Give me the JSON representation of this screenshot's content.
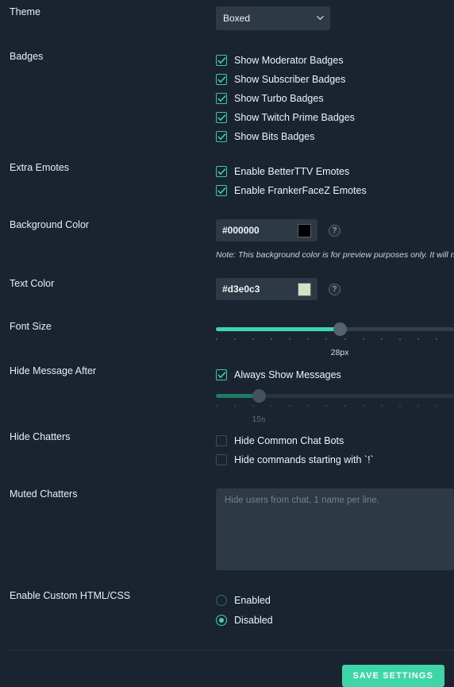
{
  "theme": {
    "label": "Theme",
    "selected": "Boxed",
    "options": [
      "Boxed"
    ],
    "chevron_icon": "chevron-down-icon"
  },
  "badges": {
    "label": "Badges",
    "items": [
      {
        "label": "Show Moderator Badges",
        "checked": true
      },
      {
        "label": "Show Subscriber Badges",
        "checked": true
      },
      {
        "label": "Show Turbo Badges",
        "checked": true
      },
      {
        "label": "Show Twitch Prime Badges",
        "checked": true
      },
      {
        "label": "Show Bits Badges",
        "checked": true
      }
    ]
  },
  "extra_emotes": {
    "label": "Extra Emotes",
    "items": [
      {
        "label": "Enable BetterTTV Emotes",
        "checked": true
      },
      {
        "label": "Enable FrankerFaceZ Emotes",
        "checked": true
      }
    ]
  },
  "background_color": {
    "label": "Background Color",
    "value": "#000000",
    "swatch": "#000000",
    "help_icon": "help-icon",
    "note": "Note: This background color is for preview purposes only. It will not be s"
  },
  "text_color": {
    "label": "Text Color",
    "value": "#d3e0c3",
    "swatch": "#d3e0c3",
    "help_icon": "help-icon"
  },
  "font_size": {
    "label": "Font Size",
    "value": "28px",
    "percent": 52
  },
  "hide_message_after": {
    "label": "Hide Message After",
    "always_show": {
      "label": "Always Show Messages",
      "checked": true
    },
    "value": "15s",
    "percent": 18
  },
  "hide_chatters": {
    "label": "Hide Chatters",
    "items": [
      {
        "label": "Hide Common Chat Bots",
        "checked": false
      },
      {
        "label": "Hide commands starting with `!`",
        "checked": false
      }
    ]
  },
  "muted_chatters": {
    "label": "Muted Chatters",
    "placeholder": "Hide users from chat, 1 name per line.",
    "value": ""
  },
  "custom_html_css": {
    "label": "Enable Custom HTML/CSS",
    "options": [
      {
        "label": "Enabled",
        "selected": false
      },
      {
        "label": "Disabled",
        "selected": true
      }
    ]
  },
  "footer": {
    "save_label": "SAVE SETTINGS"
  },
  "colors": {
    "page_background": "#1a2430",
    "accent": "#3ed6a8",
    "input_background": "#2d3a45"
  }
}
